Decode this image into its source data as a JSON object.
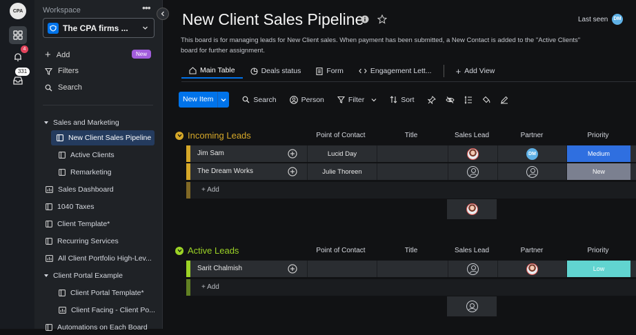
{
  "rail": {
    "logo_text": "CPA",
    "notifications_count": "4",
    "inbox_count": "331"
  },
  "sidebar": {
    "workspace_label": "Workspace",
    "workspace_name": "The CPA firms ...",
    "actions": {
      "add": "Add",
      "add_badge": "New",
      "filters": "Filters",
      "search": "Search"
    },
    "items": [
      {
        "label": "Sales and Marketing"
      },
      {
        "label": "New Client Sales Pipeline"
      },
      {
        "label": "Active Clients"
      },
      {
        "label": "Remarketing"
      },
      {
        "label": "Sales Dashboard"
      },
      {
        "label": "1040 Taxes"
      },
      {
        "label": "Client Template*"
      },
      {
        "label": "Recurring Services"
      },
      {
        "label": "All Client Portfolio High-Lev..."
      },
      {
        "label": "Client Portal Example"
      },
      {
        "label": "Client Portal Template*"
      },
      {
        "label": "Client Facing - Client Po..."
      },
      {
        "label": "Automations on Each Board"
      }
    ]
  },
  "board": {
    "title": "New Client Sales Pipeline",
    "last_seen_label": "Last seen",
    "last_seen_avatar": "DM",
    "description": "This board is for managing leads for New Client sales. When payment has been submitted, a New Contact is added to the \"Active Clients\" board for further assignment.",
    "tabs": [
      {
        "label": "Main Table"
      },
      {
        "label": "Deals status"
      },
      {
        "label": "Form"
      },
      {
        "label": "Engagement Lett..."
      },
      {
        "label": "Add View"
      }
    ]
  },
  "toolbar": {
    "new_item": "New Item",
    "search": "Search",
    "person": "Person",
    "filter": "Filter",
    "sort": "Sort"
  },
  "columns": [
    "Point of Contact",
    "Title",
    "Sales Lead",
    "Partner",
    "Priority"
  ],
  "colors": {
    "accent": "#0073ea",
    "incoming": "#d6a829",
    "active": "#9cd326",
    "medium": "#2f6fe0",
    "new": "#7b8090",
    "low": "#61d4d0"
  },
  "groups": [
    {
      "name": "Incoming Leads",
      "add_label": "+ Add",
      "rows": [
        {
          "name": "Jim Sam",
          "point_of_contact": "Lucid Day",
          "title": "",
          "sales_lead": "photo",
          "partner": "DM",
          "priority": "Medium"
        },
        {
          "name": "The Dream Works",
          "point_of_contact": "Julie Thoreen",
          "title": "",
          "sales_lead": "empty",
          "partner": "empty",
          "priority": "New"
        }
      ]
    },
    {
      "name": "Active Leads",
      "add_label": "+ Add",
      "rows": [
        {
          "name": "Sarit Chalmish",
          "point_of_contact": "",
          "title": "",
          "sales_lead": "empty",
          "partner": "photo",
          "priority": "Low"
        }
      ]
    }
  ]
}
